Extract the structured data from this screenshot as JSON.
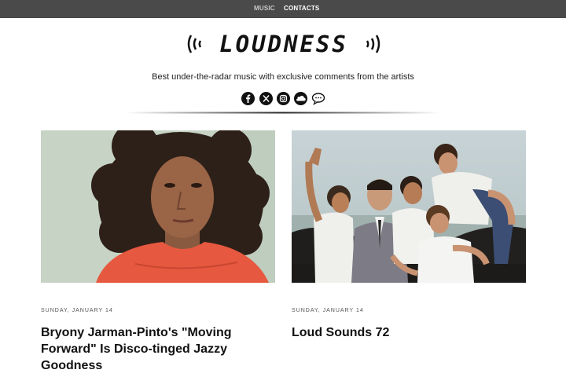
{
  "nav": {
    "music_label": "MUSIC",
    "contacts_label": "CONTACTS"
  },
  "logo": {
    "text": "LOUDNESS"
  },
  "tagline": "Best under-the-radar music with exclusive comments from the artists",
  "social": [
    {
      "icon": "facebook-icon"
    },
    {
      "icon": "x-twitter-icon"
    },
    {
      "icon": "instagram-icon"
    },
    {
      "icon": "soundcloud-icon"
    },
    {
      "icon": "chat-bubble-icon"
    }
  ],
  "posts": [
    {
      "date": "SUNDAY, JANUARY 14",
      "title": "Bryony Jarman-Pinto's \"Moving Forward\" Is Disco-tinged Jazzy Goodness",
      "image": "portrait-photo"
    },
    {
      "date": "SUNDAY, JANUARY 14",
      "title": "Loud Sounds 72",
      "image": "group-photo"
    }
  ],
  "colors": {
    "nav_bg": "#4a4a4a",
    "accent": "#111111"
  }
}
